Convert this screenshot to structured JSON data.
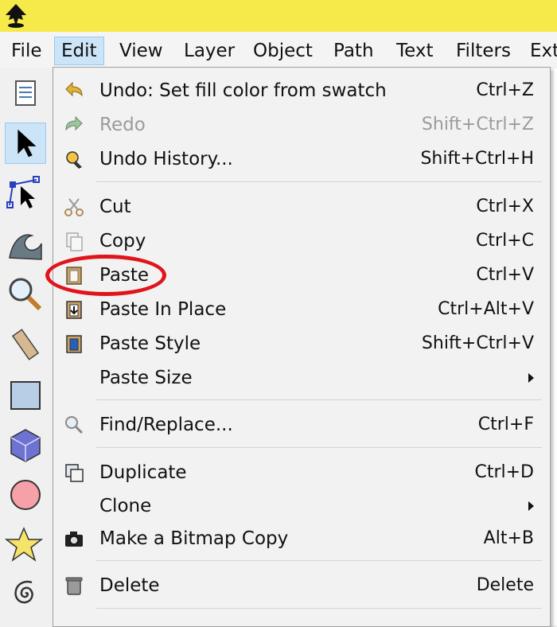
{
  "menubar": {
    "items": [
      {
        "label": "File"
      },
      {
        "label": "Edit"
      },
      {
        "label": "View"
      },
      {
        "label": "Layer"
      },
      {
        "label": "Object"
      },
      {
        "label": "Path"
      },
      {
        "label": "Text"
      },
      {
        "label": "Filters"
      },
      {
        "label": "Ext"
      }
    ]
  },
  "edit_menu": {
    "items": [
      {
        "label": "Undo: Set fill color from swatch",
        "shortcut": "Ctrl+Z",
        "icon": "undo-icon",
        "enabled": true
      },
      {
        "label": "Redo",
        "shortcut": "Shift+Ctrl+Z",
        "icon": "redo-icon",
        "enabled": false
      },
      {
        "label": "Undo History...",
        "shortcut": "Shift+Ctrl+H",
        "icon": "undo-history-icon",
        "enabled": true
      },
      {
        "label": "Cut",
        "shortcut": "Ctrl+X",
        "icon": "cut-icon",
        "enabled": false
      },
      {
        "label": "Copy",
        "shortcut": "Ctrl+C",
        "icon": "copy-icon",
        "enabled": false
      },
      {
        "label": "Paste",
        "shortcut": "Ctrl+V",
        "icon": "paste-icon",
        "enabled": true
      },
      {
        "label": "Paste In Place",
        "shortcut": "Ctrl+Alt+V",
        "icon": "paste-in-place-icon",
        "enabled": true
      },
      {
        "label": "Paste Style",
        "shortcut": "Shift+Ctrl+V",
        "icon": "paste-style-icon",
        "enabled": true
      },
      {
        "label": "Paste Size",
        "shortcut": "",
        "icon": "",
        "enabled": true,
        "submenu": true
      },
      {
        "label": "Find/Replace...",
        "shortcut": "Ctrl+F",
        "icon": "find-icon",
        "enabled": true
      },
      {
        "label": "Duplicate",
        "shortcut": "Ctrl+D",
        "icon": "duplicate-icon",
        "enabled": true
      },
      {
        "label": "Clone",
        "shortcut": "",
        "icon": "",
        "enabled": true,
        "submenu": true
      },
      {
        "label": "Make a Bitmap Copy",
        "shortcut": "Alt+B",
        "icon": "camera-icon",
        "enabled": true
      },
      {
        "label": "Delete",
        "shortcut": "Delete",
        "icon": "trash-icon",
        "enabled": true
      }
    ]
  },
  "colors": {
    "titlebar": "#f5ea4a",
    "highlight": "#e0141b",
    "menu_active": "#cce4f7"
  }
}
